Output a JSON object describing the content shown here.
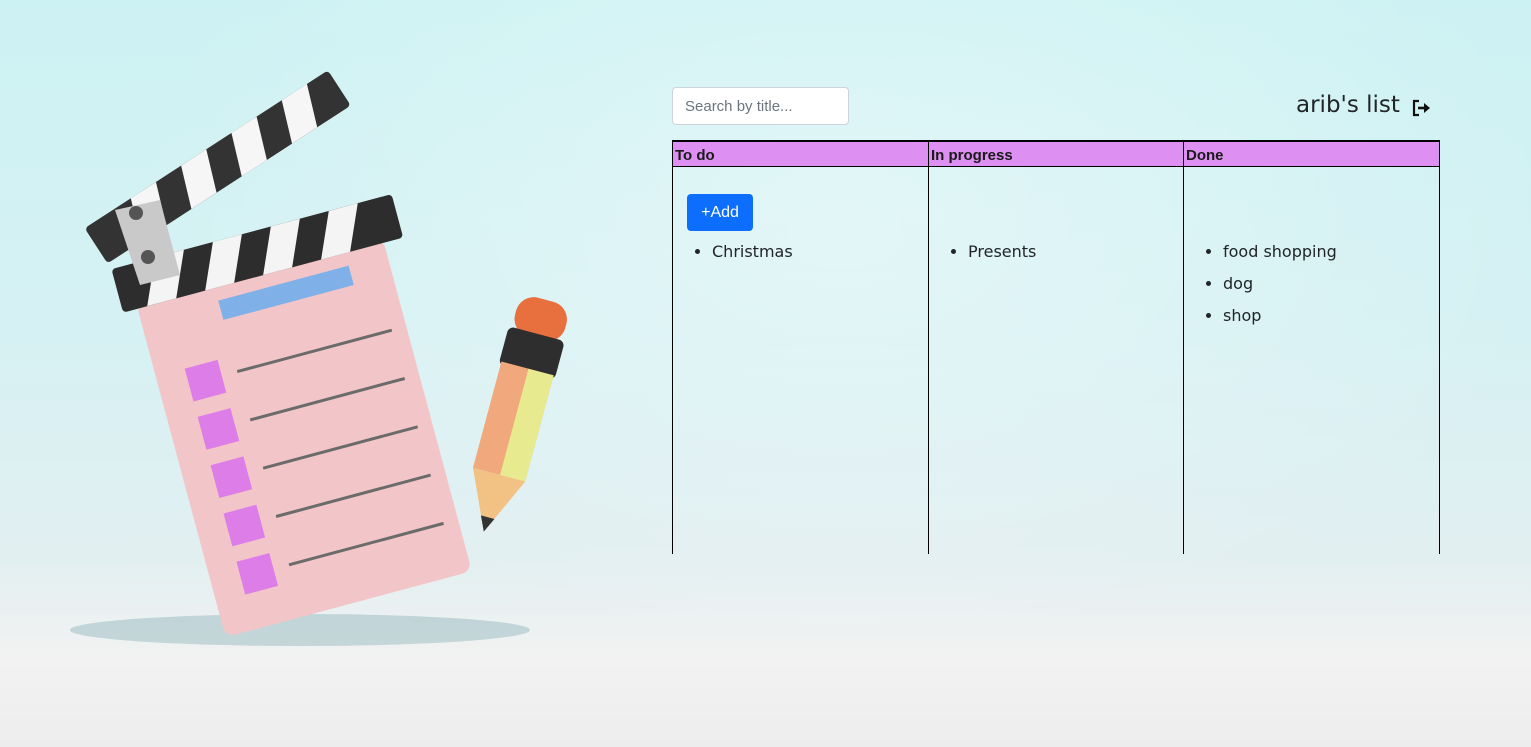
{
  "header": {
    "search_placeholder": "Search by title...",
    "list_title": "arib's list",
    "logout_icon": "sign-out-icon"
  },
  "board": {
    "columns": [
      {
        "title": "To do",
        "add_label": "+Add",
        "items": [
          "Christmas"
        ]
      },
      {
        "title": "In progress",
        "items": [
          "Presents"
        ]
      },
      {
        "title": "Done",
        "items": [
          "food shopping",
          "dog",
          "shop"
        ]
      }
    ]
  },
  "colors": {
    "header_bg": "#dd8ff2",
    "add_button": "#0d6efd"
  }
}
